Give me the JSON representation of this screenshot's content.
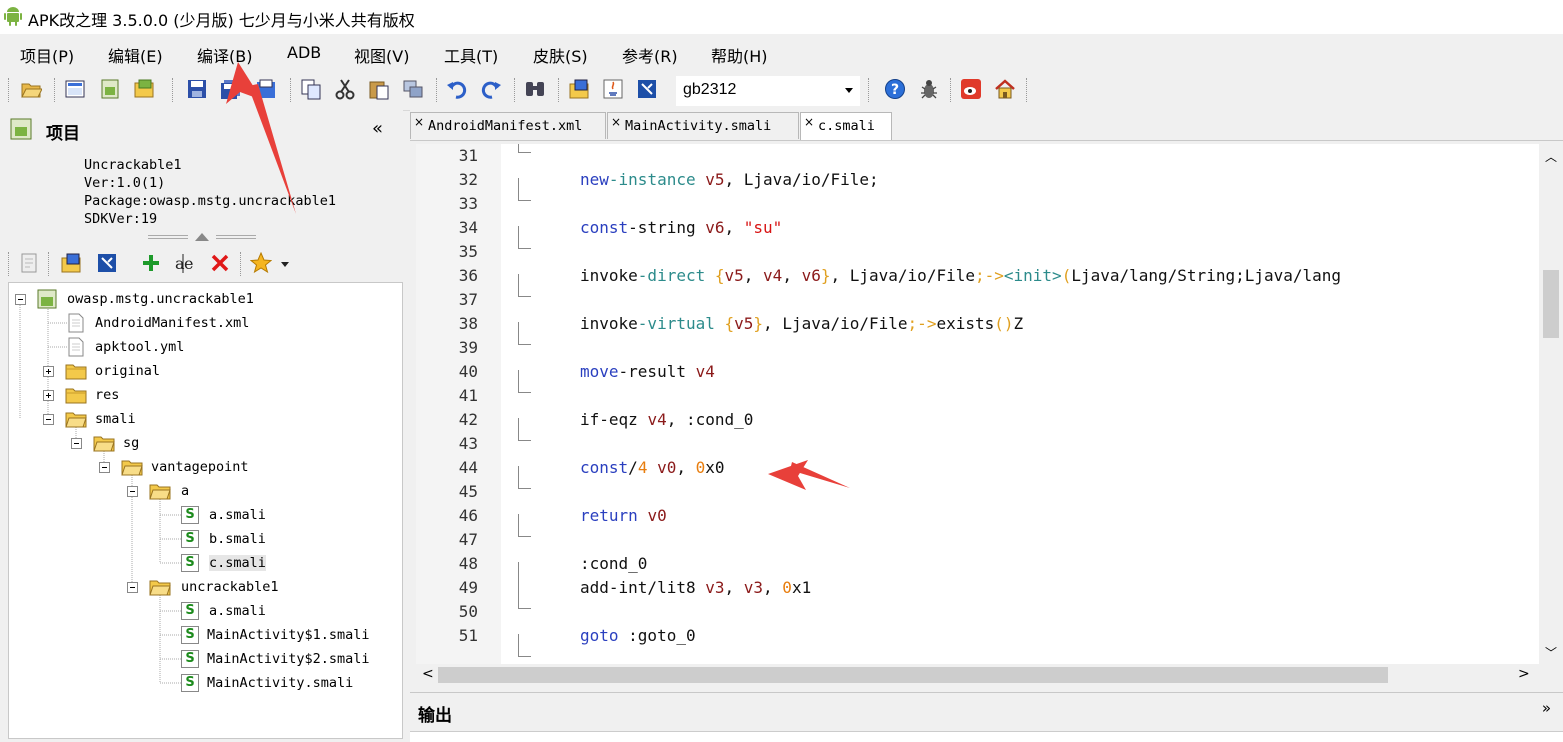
{
  "window": {
    "title": "APK改之理 3.5.0.0 (少月版)  七少月与小米人共有版权"
  },
  "menu": [
    {
      "id": "project",
      "label": "项目(P)"
    },
    {
      "id": "edit",
      "label": "编辑(E)"
    },
    {
      "id": "compile",
      "label": "编译(B)"
    },
    {
      "id": "adb",
      "label": "ADB"
    },
    {
      "id": "view",
      "label": "视图(V)"
    },
    {
      "id": "tools",
      "label": "工具(T)"
    },
    {
      "id": "skin",
      "label": "皮肤(S)"
    },
    {
      "id": "reference",
      "label": "参考(R)"
    },
    {
      "id": "help",
      "label": "帮助(H)"
    }
  ],
  "toolbar": {
    "encoding": "gb2312",
    "icons": [
      "open-folder-icon",
      "resource-icon",
      "android-build-icon",
      "sign-apk-icon",
      "save-icon",
      "save-all-icon",
      "export-icon",
      "copy-icon",
      "cut-icon",
      "paste-icon",
      "replace-icon",
      "undo-icon",
      "redo-icon",
      "find-icon",
      "smali-icon",
      "java-icon",
      "decompile-icon",
      "help-icon",
      "bug-icon",
      "weibo-icon",
      "home-icon"
    ]
  },
  "left_panel": {
    "title": "项目",
    "collapse_glyph": "«",
    "project_info": {
      "name": "Uncrackable1",
      "version": "Ver:1.0(1)",
      "package": "Package:owasp.mstg.uncrackable1",
      "sdk": "SDKVer:19"
    },
    "tree": [
      {
        "label": "owasp.mstg.uncrackable1",
        "type": "project",
        "depth": 0,
        "expander": "minus"
      },
      {
        "label": "AndroidManifest.xml",
        "type": "file",
        "depth": 1
      },
      {
        "label": "apktool.yml",
        "type": "file",
        "depth": 1
      },
      {
        "label": "original",
        "type": "folder",
        "depth": 1,
        "expander": "plus"
      },
      {
        "label": "res",
        "type": "folder",
        "depth": 1,
        "expander": "plus"
      },
      {
        "label": "smali",
        "type": "folder",
        "depth": 1,
        "expander": "minus"
      },
      {
        "label": "sg",
        "type": "folder",
        "depth": 2,
        "expander": "minus"
      },
      {
        "label": "vantagepoint",
        "type": "folder",
        "depth": 3,
        "expander": "minus"
      },
      {
        "label": "a",
        "type": "folder",
        "depth": 4,
        "expander": "minus"
      },
      {
        "label": "a.smali",
        "type": "smali",
        "depth": 5
      },
      {
        "label": "b.smali",
        "type": "smali",
        "depth": 5
      },
      {
        "label": "c.smali",
        "type": "smali",
        "depth": 5,
        "selected": true
      },
      {
        "label": "uncrackable1",
        "type": "folder",
        "depth": 4,
        "expander": "minus"
      },
      {
        "label": "a.smali",
        "type": "smali",
        "depth": 5
      },
      {
        "label": "MainActivity$1.smali",
        "type": "smali",
        "depth": 5
      },
      {
        "label": "MainActivity$2.smali",
        "type": "smali",
        "depth": 5
      },
      {
        "label": "MainActivity.smali",
        "type": "smali",
        "depth": 5
      }
    ]
  },
  "tabs": [
    {
      "label": "AndroidManifest.xml",
      "close": "×"
    },
    {
      "label": "MainActivity.smali",
      "close": "×"
    },
    {
      "label": "c.smali",
      "close": "×",
      "active": true
    }
  ],
  "code_lines": [
    {
      "n": "31",
      "tokens": []
    },
    {
      "n": "32",
      "tokens": [
        [
          "kw",
          "new"
        ],
        [
          "kg",
          "-instance"
        ],
        [
          "t",
          " "
        ],
        [
          "reg",
          "v5"
        ],
        [
          "t",
          ", Ljava/io/File;"
        ]
      ]
    },
    {
      "n": "33",
      "tokens": []
    },
    {
      "n": "34",
      "tokens": [
        [
          "kw",
          "const"
        ],
        [
          "t",
          "-string "
        ],
        [
          "reg",
          "v6"
        ],
        [
          "t",
          ", "
        ],
        [
          "str",
          "\"su\""
        ]
      ]
    },
    {
      "n": "35",
      "tokens": []
    },
    {
      "n": "36",
      "tokens": [
        [
          "t",
          "invoke"
        ],
        [
          "kg",
          "-direct"
        ],
        [
          "t",
          " "
        ],
        [
          "pun",
          "{"
        ],
        [
          "reg",
          "v5"
        ],
        [
          "t",
          ", "
        ],
        [
          "reg",
          "v4"
        ],
        [
          "t",
          ", "
        ],
        [
          "reg",
          "v6"
        ],
        [
          "pun",
          "}"
        ],
        [
          "t",
          ", Ljava/io/File"
        ],
        [
          "pun",
          ";->"
        ],
        [
          "kg",
          "<init>"
        ],
        [
          "pun",
          "("
        ],
        [
          "t",
          "Ljava/lang/String;Ljava/lang"
        ]
      ]
    },
    {
      "n": "37",
      "tokens": []
    },
    {
      "n": "38",
      "tokens": [
        [
          "t",
          "invoke"
        ],
        [
          "kg",
          "-virtual"
        ],
        [
          "t",
          " "
        ],
        [
          "pun",
          "{"
        ],
        [
          "reg",
          "v5"
        ],
        [
          "pun",
          "}"
        ],
        [
          "t",
          ", Ljava/io/File"
        ],
        [
          "pun",
          ";->"
        ],
        [
          "t",
          "exists"
        ],
        [
          "pun",
          "()"
        ],
        [
          "t",
          "Z"
        ]
      ]
    },
    {
      "n": "39",
      "tokens": []
    },
    {
      "n": "40",
      "tokens": [
        [
          "kw",
          "move"
        ],
        [
          "t",
          "-result "
        ],
        [
          "reg",
          "v4"
        ]
      ]
    },
    {
      "n": "41",
      "tokens": []
    },
    {
      "n": "42",
      "tokens": [
        [
          "t",
          "if-eqz "
        ],
        [
          "reg",
          "v4"
        ],
        [
          "t",
          ", :cond_0"
        ]
      ]
    },
    {
      "n": "43",
      "tokens": []
    },
    {
      "n": "44",
      "tokens": [
        [
          "kw",
          "const"
        ],
        [
          "t",
          "/"
        ],
        [
          "num",
          "4"
        ],
        [
          "t",
          " "
        ],
        [
          "reg",
          "v0"
        ],
        [
          "t",
          ", "
        ],
        [
          "num",
          "0"
        ],
        [
          "t",
          "x0"
        ]
      ]
    },
    {
      "n": "45",
      "tokens": []
    },
    {
      "n": "46",
      "tokens": [
        [
          "kw",
          "return"
        ],
        [
          "t",
          " "
        ],
        [
          "reg",
          "v0"
        ]
      ]
    },
    {
      "n": "47",
      "tokens": []
    },
    {
      "n": "48",
      "tokens": [
        [
          "t",
          ":cond_0"
        ]
      ]
    },
    {
      "n": "49",
      "tokens": [
        [
          "t",
          "add-int/lit8 "
        ],
        [
          "reg",
          "v3"
        ],
        [
          "t",
          ", "
        ],
        [
          "reg",
          "v3"
        ],
        [
          "t",
          ", "
        ],
        [
          "num",
          "0"
        ],
        [
          "t",
          "x1"
        ]
      ]
    },
    {
      "n": "50",
      "tokens": []
    },
    {
      "n": "51",
      "tokens": [
        [
          "kw",
          "goto"
        ],
        [
          "t",
          " :goto_0"
        ]
      ]
    }
  ],
  "output_panel": {
    "title": "输出",
    "chevron": "»"
  },
  "colors": {
    "keyword": "#2a3fbf",
    "keyword2": "#2c8b8b",
    "register": "#8b1a1a",
    "number": "#e87d0d",
    "string": "#d81414",
    "annotation_arrow": "#e8403a"
  }
}
